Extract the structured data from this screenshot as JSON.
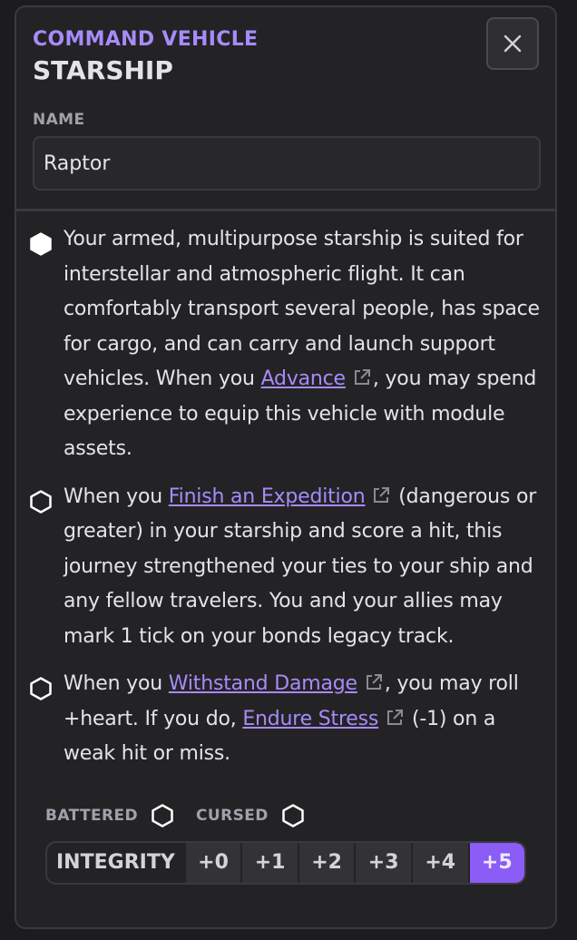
{
  "header": {
    "subtitle": "COMMAND VEHICLE",
    "title": "STARSHIP",
    "close_icon": "close-icon"
  },
  "name_field": {
    "label": "NAME",
    "value": "Raptor"
  },
  "abilities": [
    {
      "checked": true,
      "text_1": "Your armed, multipurpose starship is suited for interstellar and atmospheric flight. It can comfortably transport several people, has space for cargo, and can carry and launch support vehicles. When you ",
      "link_1": "Advance",
      "text_2": ", you may spend experience to equip this vehicle with module assets."
    },
    {
      "checked": false,
      "text_1": "When you ",
      "link_1": "Finish an Expedition",
      "text_2": " (dangerous or greater) in your starship and score a hit, this journey strengthened your ties to your ship and any fellow travelers. You and your allies may mark 1 tick on your bonds legacy track."
    },
    {
      "checked": false,
      "text_1": "When you ",
      "link_1": "Withstand Damage",
      "text_2": ", you may roll +heart. If you do, ",
      "link_2": "Endure Stress",
      "text_3": " (-1) on a weak hit or miss."
    }
  ],
  "conditions": [
    {
      "label": "BATTERED",
      "checked": false
    },
    {
      "label": "CURSED",
      "checked": false
    }
  ],
  "integrity": {
    "label": "INTEGRITY",
    "steps": [
      "+0",
      "+1",
      "+2",
      "+3",
      "+4",
      "+5"
    ],
    "selected": "+5"
  },
  "colors": {
    "accent": "#a78bfa",
    "active_step": "#8b5cf6",
    "background": "#232325"
  }
}
